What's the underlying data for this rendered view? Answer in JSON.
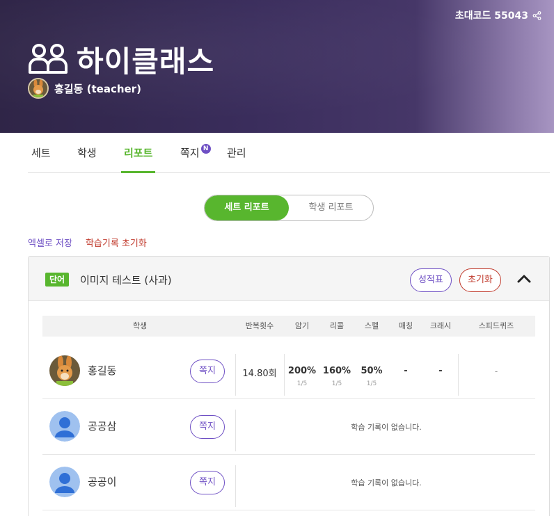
{
  "header": {
    "invite_label": "초대코드 55043",
    "class_name": "하이클래스",
    "owner": "홍길동  (teacher)"
  },
  "tabs": [
    {
      "label": "세트",
      "active": false
    },
    {
      "label": "학생",
      "active": false
    },
    {
      "label": "리포트",
      "active": true
    },
    {
      "label": "쪽지",
      "active": false,
      "badge": "N"
    },
    {
      "label": "관리",
      "active": false
    }
  ],
  "segment": {
    "set_report": "세트 리포트",
    "student_report": "학생 리포트"
  },
  "links": {
    "excel": "엑셀로 저장",
    "reset_history": "학습기록 초기화"
  },
  "set_panel": {
    "chip": "단어",
    "title": "이미지 테스트 (사과)",
    "score_button": "성적표",
    "reset_button": "초기화"
  },
  "table": {
    "headers": {
      "student": "학생",
      "repeat": "반복횟수",
      "memorize": "암기",
      "recall": "리콜",
      "spell": "스펠",
      "matching": "매칭",
      "crash": "크래시",
      "speed_quiz": "스피드퀴즈"
    },
    "rows": [
      {
        "name": "홍길동",
        "note_button": "쪽지",
        "repeat": "14.80회",
        "memorize": "200%",
        "memorize_sub": "1/5",
        "recall": "160%",
        "recall_sub": "1/5",
        "spell": "50%",
        "spell_sub": "1/5",
        "matching": "-",
        "crash": "-",
        "speed_quiz": "-"
      },
      {
        "name": "공공삼",
        "note_button": "쪽지",
        "empty_text": "학습 기록이 없습니다."
      },
      {
        "name": "공공이",
        "note_button": "쪽지",
        "empty_text": "학습 기록이 없습니다."
      }
    ]
  },
  "colors": {
    "accent_green": "#58b62e",
    "accent_purple": "#6e4fc4",
    "danger_red": "#c0392b"
  }
}
